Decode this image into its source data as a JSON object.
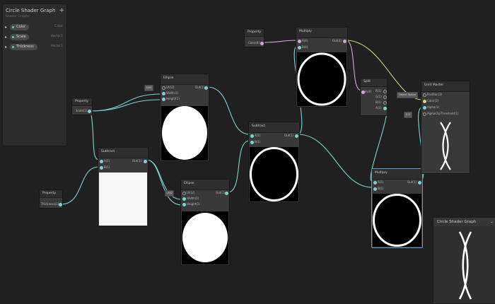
{
  "blackboard": {
    "title": "Circle Shader Graph",
    "subtitle": "Shader Graphs",
    "add_label": "+",
    "properties": [
      {
        "name": "Color",
        "type": "Color"
      },
      {
        "name": "Scale",
        "type": "Vector1"
      },
      {
        "name": "Thickness",
        "type": "Vector1"
      }
    ]
  },
  "nodes": {
    "property_color": {
      "title": "Property",
      "out": "Color(4)"
    },
    "property_scale": {
      "title": "Property",
      "out": "Scale(1)"
    },
    "property_thickness": {
      "title": "Property",
      "out": "Thickness(1)"
    },
    "ellipse1": {
      "title": "Ellipse",
      "in": [
        "UV(2)",
        "Width(1)",
        "Height(1)"
      ],
      "out": "Out(1)",
      "uv_tag": "UV0"
    },
    "ellipse2": {
      "title": "Ellipse",
      "in": [
        "UV(2)",
        "Width(1)",
        "Height(1)"
      ],
      "out": "Out(1)",
      "uv_tag": "UV0"
    },
    "subtract1": {
      "title": "Subtract",
      "in": [
        "A(1)",
        "B(1)"
      ],
      "out": "Out(1)"
    },
    "subtract2": {
      "title": "Subtract",
      "in": [
        "A(1)",
        "B(1)"
      ],
      "out": "Out(1)"
    },
    "multiply1": {
      "title": "Multiply",
      "in": [
        "A(4)",
        "B(4)"
      ],
      "out": "Out(4)"
    },
    "multiply2": {
      "title": "Multiply",
      "in": [
        "A(1)",
        "B(1)"
      ],
      "out": "Out(1)"
    },
    "split": {
      "title": "Split",
      "in": [
        "In(4)"
      ],
      "out": [
        "R(1)",
        "G(1)",
        "B(1)",
        "A(1)"
      ]
    },
    "unlit_master": {
      "title": "Unlit Master",
      "in": [
        "Position(3)",
        "Color(3)",
        "Alpha(1)",
        "AlphaClipThreshold(1)"
      ],
      "tags": [
        "Object Space",
        "0.5"
      ]
    }
  },
  "main_preview": {
    "title": "Circle Shader Graph",
    "toggle": "⌄"
  },
  "colors": {
    "background": "#202020",
    "node": "#393939",
    "wire_float": "#7fd1d1",
    "wire_color": "#cfa6d6",
    "wire_vec3": "#d6d67a",
    "selected": "#5a9ad4"
  }
}
